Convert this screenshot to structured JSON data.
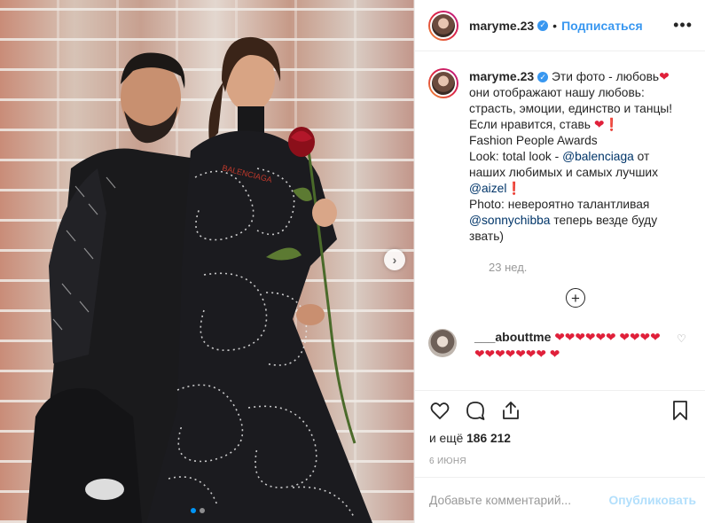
{
  "post": {
    "username": "maryme.23",
    "separator": "•",
    "follow_label": "Подписаться",
    "more_label": "•••"
  },
  "caption": {
    "username": "maryme.23",
    "line1": "Эти фото - любовь",
    "line2": "они отображают нашу любовь:",
    "line3": "страсть, эмоции, единство и танцы!",
    "line4": "Если нравится, ставь",
    "line5": "Fashion People Awards",
    "line6_prefix": "Look: total look - ",
    "line6_tag": "@balenciaga",
    "line6_suffix": " от",
    "line7": "наших любимых и самых лучших",
    "line8_tag": "@aizel",
    "line9": "Photo: невероятно талантливая",
    "line10_tag": "@sonnychibba",
    "line10_suffix": " теперь везде буду",
    "line11": "звать)",
    "heart": "❤",
    "exclaim": "❗"
  },
  "post_time": "23 нед.",
  "load_more_label": "+",
  "comment": {
    "username": "___abouttme",
    "hearts": "❤❤❤❤❤❤ ❤❤❤❤❤❤❤❤❤❤❤ ❤",
    "like_icon": "♡"
  },
  "likes": {
    "prefix": "и ещё",
    "count": "186 212"
  },
  "date": "6 ИЮНЯ",
  "comment_input": {
    "placeholder": "Добавьте комментарий...",
    "publish_label": "Опубликовать"
  },
  "carousel": {
    "next_label": "›",
    "current": 1,
    "total": 2
  },
  "colors": {
    "accent": "#3897f0",
    "heart": "#e0203a",
    "publish_disabled": "#b2dffc"
  }
}
